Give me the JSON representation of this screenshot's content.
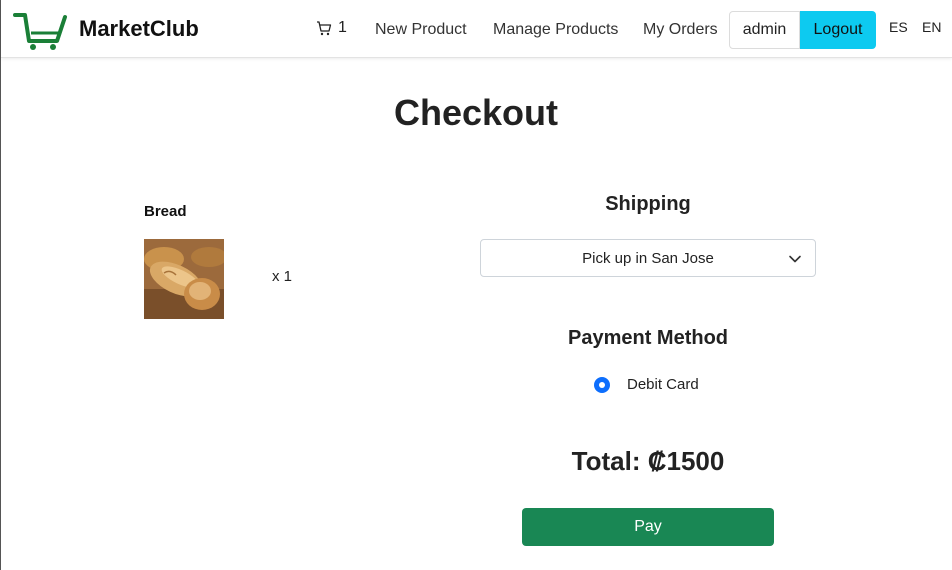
{
  "navbar": {
    "brand": "MarketClub",
    "cart_count": "1",
    "links": [
      "New Product",
      "Manage Products",
      "My Orders"
    ],
    "user_label": "admin",
    "logout_label": "Logout",
    "languages": [
      "ES",
      "EN"
    ]
  },
  "checkout": {
    "title": "Checkout",
    "items": [
      {
        "name": "Bread",
        "quantity": "x 1"
      }
    ],
    "shipping": {
      "title": "Shipping",
      "selected": "Pick up in San Jose"
    },
    "payment": {
      "title": "Payment Method",
      "options": [
        {
          "label": "Debit Card",
          "selected": true
        }
      ]
    },
    "total": "Total: ₡1500",
    "pay_label": "Pay"
  },
  "colors": {
    "brand_green": "#1a7f37",
    "logout_bg": "#0dcaf0",
    "pay_bg": "#198754",
    "radio_selected": "#0d6efd"
  }
}
